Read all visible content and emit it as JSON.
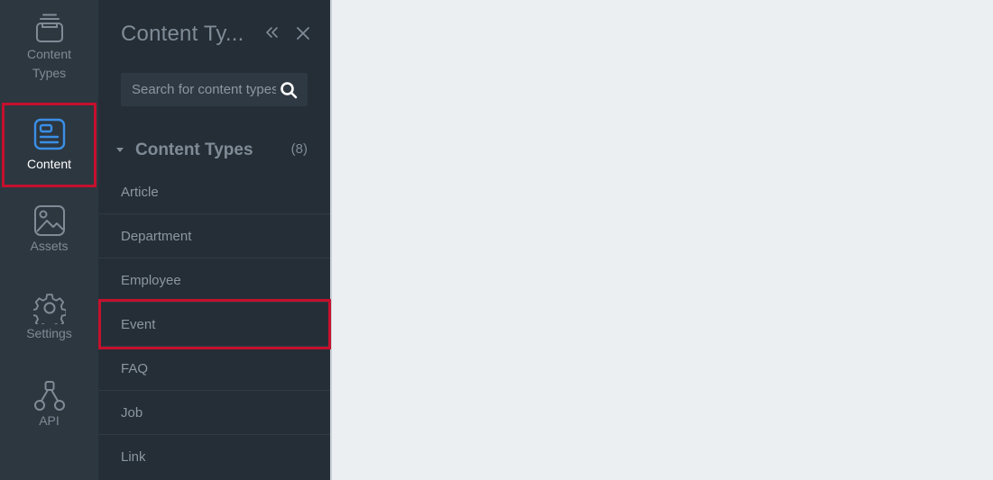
{
  "rail": {
    "items": [
      {
        "label": "Content Types",
        "icon": "content-types-icon",
        "active": false
      },
      {
        "label": "Content",
        "icon": "content-icon",
        "active": true
      },
      {
        "label": "Assets",
        "icon": "image-icon",
        "active": false
      },
      {
        "label": "Settings",
        "icon": "gear-icon",
        "active": false
      },
      {
        "label": "API",
        "icon": "api-icon",
        "active": false
      }
    ]
  },
  "panel": {
    "title": "Content Ty...",
    "search_placeholder": "Search for content types",
    "group": {
      "label": "Content Types",
      "count": "(8)"
    },
    "types": [
      "Article",
      "Department",
      "Employee",
      "Event",
      "FAQ",
      "Job",
      "Link"
    ]
  },
  "colors": {
    "rail_bg": "#2d3740",
    "panel_bg": "#252e37",
    "accent_blue": "#3a8fe6",
    "highlight_red": "#c5102d",
    "main_bg": "#eceff2"
  }
}
